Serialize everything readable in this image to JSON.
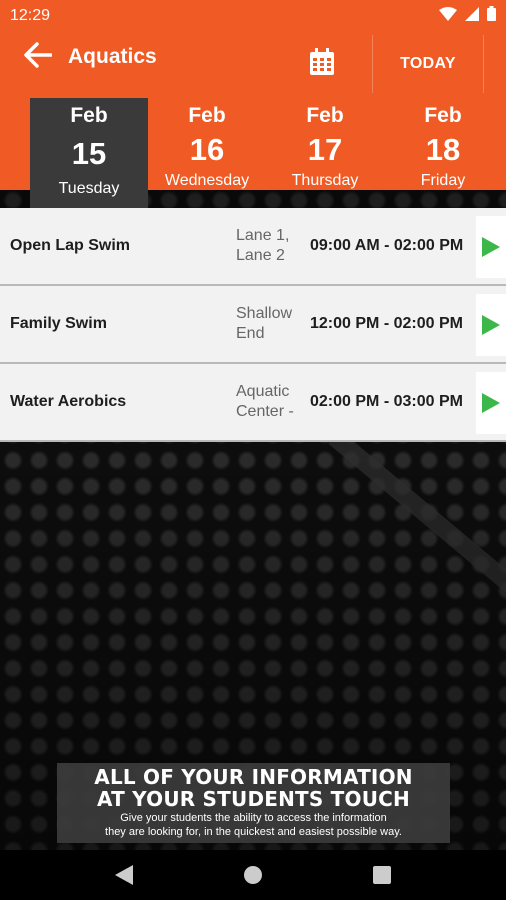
{
  "status_bar": {
    "time": "12:29",
    "icons": [
      "wifi-icon",
      "signal-icon",
      "battery-icon"
    ]
  },
  "app_bar": {
    "title": "Aquatics",
    "back_icon": "arrow-left-icon",
    "calendar_icon": "calendar-icon",
    "today_label": "TODAY"
  },
  "dates": [
    {
      "month": "Feb",
      "day": "15",
      "weekday": "Tuesday",
      "selected": true
    },
    {
      "month": "Feb",
      "day": "16",
      "weekday": "Wednesday",
      "selected": false
    },
    {
      "month": "Feb",
      "day": "17",
      "weekday": "Thursday",
      "selected": false
    },
    {
      "month": "Feb",
      "day": "18",
      "weekday": "Friday",
      "selected": false
    }
  ],
  "events": [
    {
      "name": "Open Lap Swim",
      "location": "Lane 1, Lane 2",
      "time": "09:00 AM - 02:00 PM"
    },
    {
      "name": "Family Swim",
      "location": "Shallow End",
      "time": "12:00 PM - 02:00 PM"
    },
    {
      "name": "Water Aerobics",
      "location": "Aquatic Center -",
      "time": "02:00 PM - 03:00 PM"
    }
  ],
  "promo": {
    "headline_1": "ALL OF YOUR INFORMATION",
    "headline_2": "AT YOUR STUDENTS TOUCH",
    "sub_1": "Give your students the ability to access the information",
    "sub_2": "they are looking for, in the quickest and easiest possible way."
  },
  "nav": {
    "back_icon": "triangle-back-icon",
    "home_icon": "circle-home-icon",
    "recents_icon": "square-recents-icon"
  },
  "colors": {
    "brand_orange": "#f05a24",
    "selected_date_bg": "#3a3a3a",
    "play_green": "#3cb84a"
  }
}
